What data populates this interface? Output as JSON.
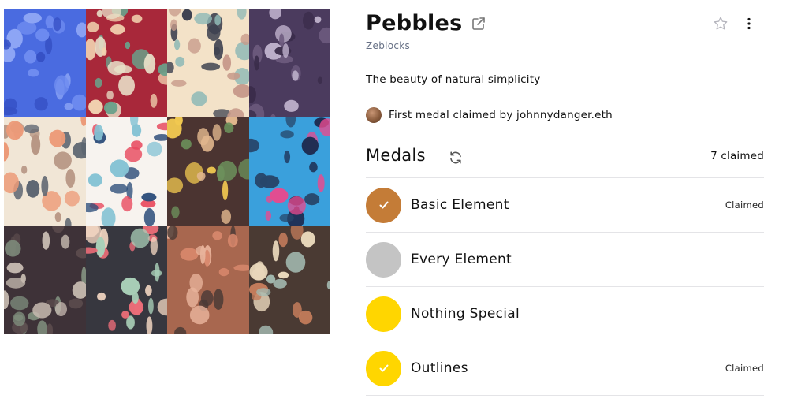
{
  "collection": {
    "title": "Pebbles",
    "creator": "Zeblocks",
    "description": "The beauty of natural simplicity",
    "first_medal": "First medal claimed by johnnydanger.eth"
  },
  "icons": {
    "external_link": "external-link-icon",
    "favorite": "star-outline-icon",
    "more": "kebab-menu-icon",
    "refresh": "refresh-icon",
    "check": "check-icon"
  },
  "medals": {
    "heading": "Medals",
    "claimed_count": "7 claimed",
    "items": [
      {
        "name": "Basic Element",
        "status": "Claimed",
        "color": "#c47c37",
        "checked": true
      },
      {
        "name": "Every Element",
        "status": "",
        "color": "#c4c4c4",
        "checked": false
      },
      {
        "name": "Nothing Special",
        "status": "",
        "color": "#ffd600",
        "checked": false
      },
      {
        "name": "Outlines",
        "status": "Claimed",
        "color": "#ffd600",
        "checked": true
      }
    ]
  },
  "artwork": {
    "tiles": [
      {
        "bg": "#4a6be0",
        "colors": [
          "#6f8cf0",
          "#3550c4",
          "#8ea6f5"
        ]
      },
      {
        "bg": "#a8283a",
        "colors": [
          "#e8e0c8",
          "#f2d3b0",
          "#6aa08a"
        ]
      },
      {
        "bg": "#f3e2c8",
        "colors": [
          "#3e4150",
          "#c79a8a",
          "#8fb9b6"
        ]
      },
      {
        "bg": "#4b3b5e",
        "colors": [
          "#6f5d80",
          "#bfb2cc",
          "#3a2c4a"
        ]
      },
      {
        "bg": "#f1e6d6",
        "colors": [
          "#5c6470",
          "#b79684",
          "#ec9a78"
        ]
      },
      {
        "bg": "#f7f3ef",
        "colors": [
          "#2d4d7a",
          "#e84a5f",
          "#86c3d4"
        ]
      },
      {
        "bg": "#4b3431",
        "colors": [
          "#e2b78e",
          "#6c8f5b",
          "#f0c850"
        ]
      },
      {
        "bg": "#3aa0dc",
        "colors": [
          "#1e2d52",
          "#e84a8e",
          "#27476b"
        ]
      },
      {
        "bg": "#3e3238",
        "colors": [
          "#7e8c7c",
          "#c4b8ae",
          "#5a4a4c"
        ]
      },
      {
        "bg": "#37373f",
        "colors": [
          "#ec6d78",
          "#a9cfb8",
          "#f3d7c2"
        ]
      },
      {
        "bg": "#a8674f",
        "colors": [
          "#e8b39b",
          "#4a3a36",
          "#d8886c"
        ]
      },
      {
        "bg": "#4a3a33",
        "colors": [
          "#e9d7bb",
          "#a3b9b0",
          "#c27b5b"
        ]
      }
    ]
  }
}
